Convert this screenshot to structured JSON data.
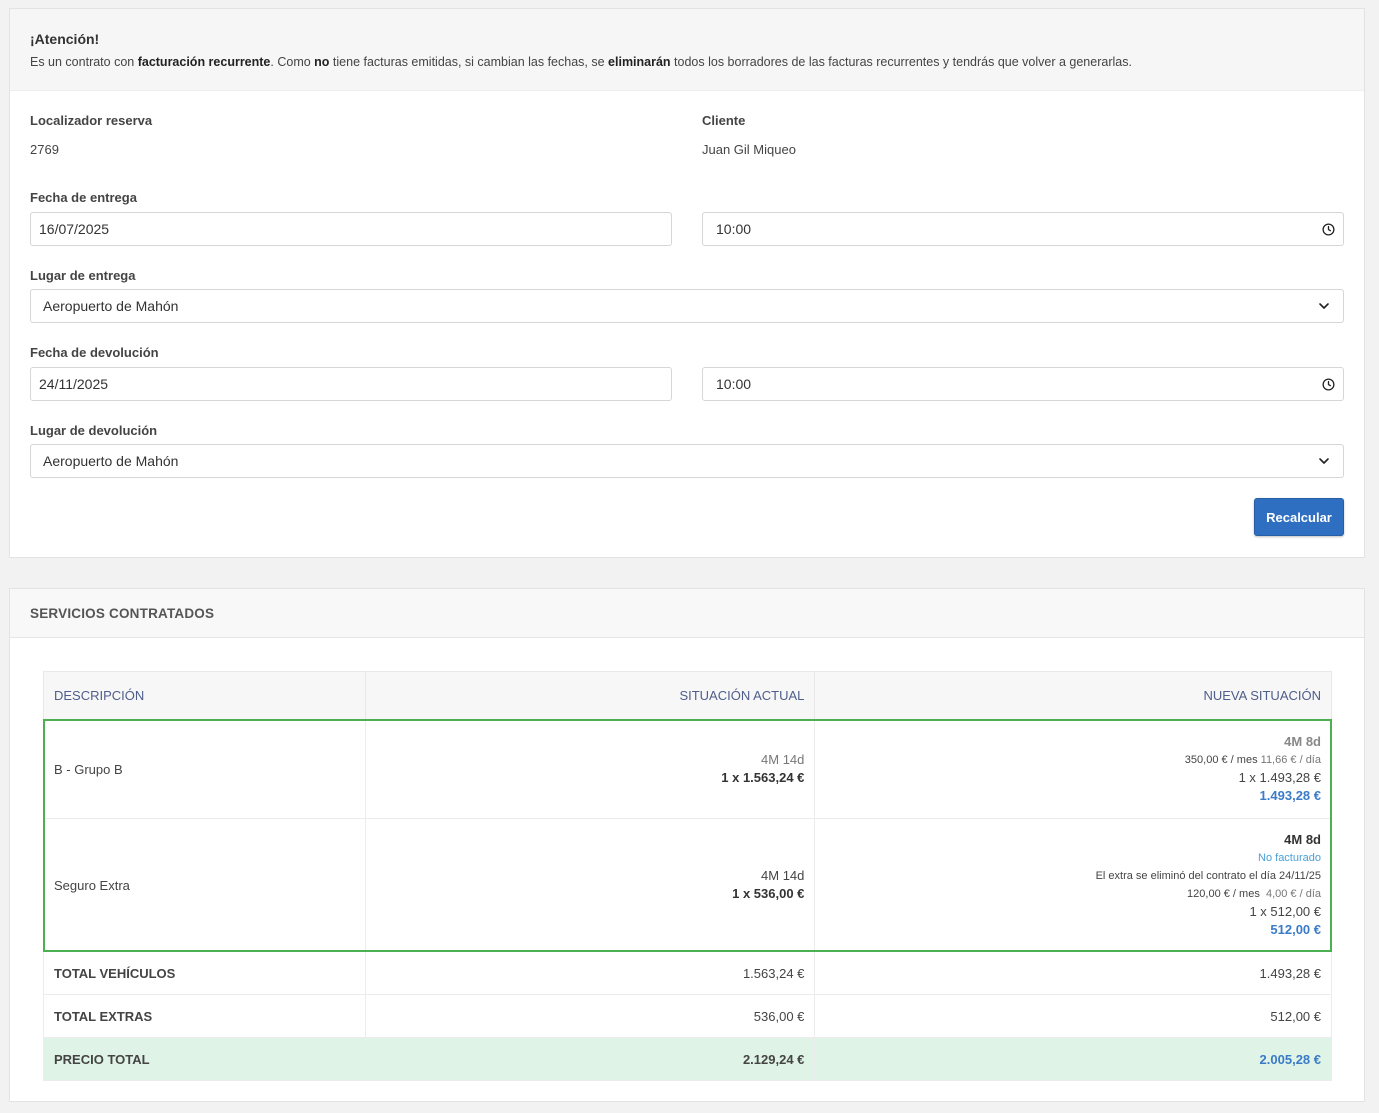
{
  "alert": {
    "title": "¡Atención!",
    "p1": "Es un contrato con ",
    "b1": "facturación recurrente",
    "p2": ". Como ",
    "b2": "no",
    "p3": " tiene facturas emitidas, si cambian las fechas, se ",
    "b3": "eliminarán",
    "p4": " todos los borradores de las facturas recurrentes y tendrás que volver a generarlas."
  },
  "form": {
    "locator_label": "Localizador reserva",
    "locator_value": "2769",
    "client_label": "Cliente",
    "client_value": "Juan Gil Miqueo",
    "delivery_date_label": "Fecha de entrega",
    "delivery_date": "16/07/2025",
    "delivery_time": "10:00",
    "delivery_place_label": "Lugar de entrega",
    "delivery_place": "Aeropuerto de Mahón",
    "return_date_label": "Fecha de devolución",
    "return_date": "24/11/2025",
    "return_time": "10:00",
    "return_place_label": "Lugar de devolución",
    "return_place": "Aeropuerto de Mahón",
    "recalc_button": "Recalcular"
  },
  "services": {
    "title": "SERVICIOS CONTRATADOS",
    "headers": [
      "DESCRIPCIÓN",
      "SITUACIÓN ACTUAL",
      "NUEVA SITUACIÓN"
    ],
    "rows": [
      {
        "desc": "B - Grupo B",
        "current_period": "4M 14d",
        "current_price": "1 x 1.563,24 €",
        "new_period": "4M 8d",
        "new_rate_month": "350,00 € / mes",
        "new_rate_day": "11,66 € / día",
        "new_qty_price": "1 x 1.493,28 €",
        "new_total": "1.493,28 €"
      },
      {
        "desc": "Seguro Extra",
        "current_period": "4M 14d",
        "current_price": "1 x 536,00 €",
        "new_period": "4M 8d",
        "new_status": "No facturado",
        "new_note": "El extra se eliminó del contrato el día 24/11/25",
        "new_rate_month": "120,00 € / mes",
        "new_rate_day": "4,00 € / día",
        "new_qty_price": "1 x 512,00 €",
        "new_total": "512,00 €"
      }
    ],
    "totals": [
      {
        "label": "TOTAL VEHÍCULOS",
        "current": "1.563,24 €",
        "new": "1.493,28 €"
      },
      {
        "label": "TOTAL EXTRAS",
        "current": "536,00 €",
        "new": "512,00 €"
      }
    ],
    "price_total": {
      "label": "PRECIO TOTAL",
      "current": "2.129,24 €",
      "new": "2.005,28 €"
    }
  },
  "colors": {
    "accent": "#2f6fc1",
    "highlight_border": "#4caf50",
    "total_row_bg": "#dff3e7",
    "link_blue": "#3a7bc8"
  },
  "icons": {
    "clock": "clock-icon",
    "chevron": "chevron-down-icon"
  }
}
